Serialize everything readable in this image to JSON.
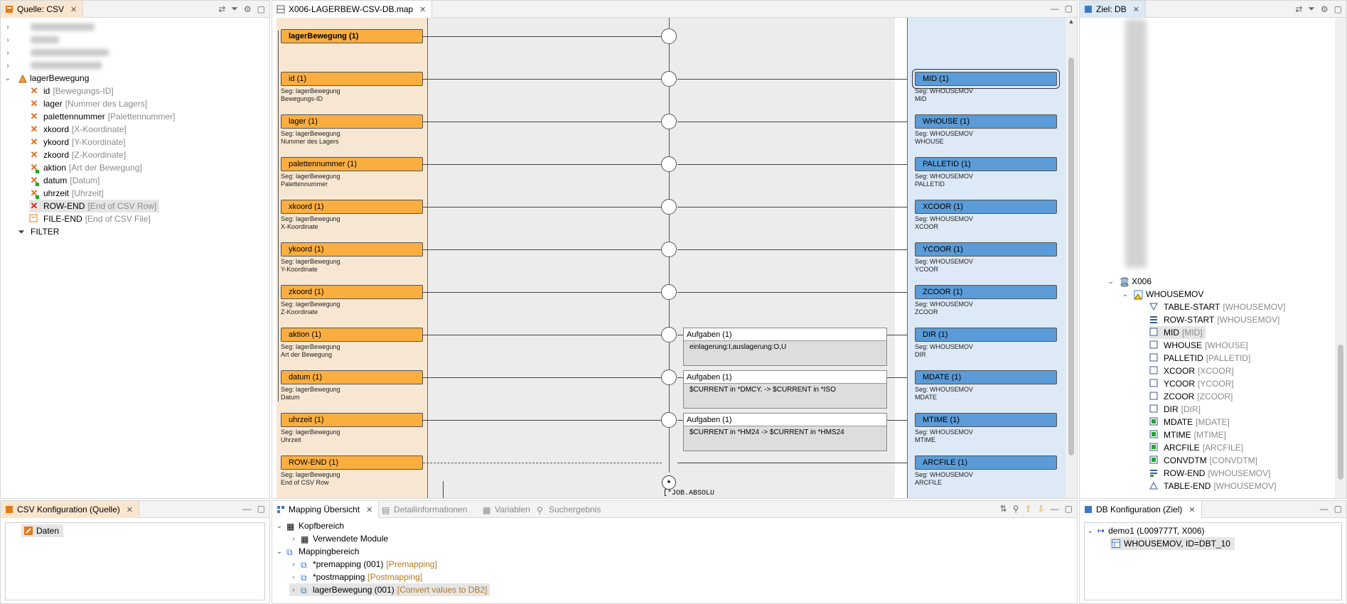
{
  "source_pane": {
    "tab": "Quelle: CSV",
    "root": "lagerBewegung",
    "fields": [
      {
        "name": "id",
        "hint": "[Bewegungs-ID]",
        "mark": "x"
      },
      {
        "name": "lager",
        "hint": "[Nummer des Lagers]",
        "mark": "x"
      },
      {
        "name": "palettennummer",
        "hint": "[Palettennummer]",
        "mark": "x"
      },
      {
        "name": "xkoord",
        "hint": "[X-Koordinate]",
        "mark": "x"
      },
      {
        "name": "ykoord",
        "hint": "[Y-Koordinate]",
        "mark": "x"
      },
      {
        "name": "zkoord",
        "hint": "[Z-Koordinate]",
        "mark": "x"
      },
      {
        "name": "aktion",
        "hint": "[Art der Bewegung]",
        "mark": "xg"
      },
      {
        "name": "datum",
        "hint": "[Datum]",
        "mark": "xg"
      },
      {
        "name": "uhrzeit",
        "hint": "[Uhrzeit]",
        "mark": "xg"
      },
      {
        "name": "ROW-END",
        "hint": "[End of CSV Row]",
        "mark": "xr"
      },
      {
        "name": "FILE-END",
        "hint": "[End of CSV File]",
        "mark": "doc"
      }
    ],
    "filter": "FILTER"
  },
  "map_pane": {
    "tab": "X006-LAGERBEW-CSV-DB.map",
    "header_box": "lagerBewegung (1)",
    "rows": [
      {
        "src": "id (1)",
        "seg1": "Seg: lagerBewegung",
        "seg2": "Bewegungs-ID",
        "tgt": "MID (1)",
        "tseg1": "Seg: WHOUSEMOV",
        "tseg2": "MID"
      },
      {
        "src": "lager (1)",
        "seg1": "Seg: lagerBewegung",
        "seg2": "Nummer des Lagers",
        "tgt": "WHOUSE (1)",
        "tseg1": "Seg: WHOUSEMOV",
        "tseg2": "WHOUSE"
      },
      {
        "src": "palettennummer (1)",
        "seg1": "Seg: lagerBewegung",
        "seg2": "Palettennummer",
        "tgt": "PALLETID (1)",
        "tseg1": "Seg: WHOUSEMOV",
        "tseg2": "PALLETID"
      },
      {
        "src": "xkoord (1)",
        "seg1": "Seg: lagerBewegung",
        "seg2": "X-Koordinate",
        "tgt": "XCOOR (1)",
        "tseg1": "Seg: WHOUSEMOV",
        "tseg2": "XCOOR"
      },
      {
        "src": "ykoord (1)",
        "seg1": "Seg: lagerBewegung",
        "seg2": "Y-Koordinate",
        "tgt": "YCOOR (1)",
        "tseg1": "Seg: WHOUSEMOV",
        "tseg2": "YCOOR"
      },
      {
        "src": "zkoord (1)",
        "seg1": "Seg: lagerBewegung",
        "seg2": "Z-Koordinate",
        "tgt": "ZCOOR (1)",
        "tseg1": "Seg: WHOUSEMOV",
        "tseg2": "ZCOOR"
      },
      {
        "src": "aktion (1)",
        "seg1": "Seg: lagerBewegung",
        "seg2": "Art der Bewegung",
        "tgt": "DIR (1)",
        "tseg1": "Seg: WHOUSEMOV",
        "tseg2": "DIR"
      },
      {
        "src": "datum (1)",
        "seg1": "Seg: lagerBewegung",
        "seg2": "Datum",
        "tgt": "MDATE (1)",
        "tseg1": "Seg: WHOUSEMOV",
        "tseg2": "MDATE"
      },
      {
        "src": "uhrzeit (1)",
        "seg1": "Seg: lagerBewegung",
        "seg2": "Uhrzeit",
        "tgt": "MTIME (1)",
        "tseg1": "Seg: WHOUSEMOV",
        "tseg2": "MTIME"
      },
      {
        "src": "ROW-END (1)",
        "seg1": "Seg: lagerBewegung",
        "seg2": "End of CSV Row",
        "tgt": "ARCFILE (1)",
        "tseg1": "Seg: WHOUSEMOV",
        "tseg2": "ARCFILE"
      }
    ],
    "tasks": [
      {
        "title": "Aufgaben (1)",
        "body": "einlagerung:I,auslagerung:O,U"
      },
      {
        "title": "Aufgaben (1)",
        "body": "$CURRENT in *DMCY. -> $CURRENT in *ISO"
      },
      {
        "title": "Aufgaben (1)",
        "body": "$CURRENT in *HM24 -> $CURRENT in *HMS24"
      }
    ],
    "job_label": "[*JOB.ABSOLU",
    "star": "*"
  },
  "target_pane": {
    "tab": "Ziel: DB",
    "db": "X006",
    "table": "WHOUSEMOV",
    "fields": [
      {
        "name": "TABLE-START",
        "hint": "[WHOUSEMOV]",
        "icon": "tri-down"
      },
      {
        "name": "ROW-START",
        "hint": "[WHOUSEMOV]",
        "icon": "lines"
      },
      {
        "name": "MID",
        "hint": "[MID]",
        "icon": "empty"
      },
      {
        "name": "WHOUSE",
        "hint": "[WHOUSE]",
        "icon": "empty"
      },
      {
        "name": "PALLETID",
        "hint": "[PALLETID]",
        "icon": "empty"
      },
      {
        "name": "XCOOR",
        "hint": "[XCOOR]",
        "icon": "empty"
      },
      {
        "name": "YCOOR",
        "hint": "[YCOOR]",
        "icon": "empty"
      },
      {
        "name": "ZCOOR",
        "hint": "[ZCOOR]",
        "icon": "empty"
      },
      {
        "name": "DIR",
        "hint": "[DIR]",
        "icon": "empty"
      },
      {
        "name": "MDATE",
        "hint": "[MDATE]",
        "icon": "green"
      },
      {
        "name": "MTIME",
        "hint": "[MTIME]",
        "icon": "green"
      },
      {
        "name": "ARCFILE",
        "hint": "[ARCFILE]",
        "icon": "green"
      },
      {
        "name": "CONVDTM",
        "hint": "[CONVDTM]",
        "icon": "green"
      },
      {
        "name": "ROW-END",
        "hint": "[WHOUSEMOV]",
        "icon": "lines-green"
      },
      {
        "name": "TABLE-END",
        "hint": "[WHOUSEMOV]",
        "icon": "tri-up"
      }
    ]
  },
  "csv_config": {
    "tab": "CSV Konfiguration (Quelle)",
    "item": "Daten"
  },
  "overview": {
    "tabs": [
      "Mapping Übersicht",
      "Detailinformationen",
      "Variablen",
      "Suchergebnis"
    ],
    "kopf": "Kopfbereich",
    "module": "Verwendete Module",
    "mapping": "Mappingbereich",
    "items": [
      {
        "label": "*premapping (001)",
        "hint": "[Premapping]"
      },
      {
        "label": "*postmapping",
        "hint": "[Postmapping]"
      },
      {
        "label": "lagerBewegung (001)",
        "hint": "[Convert values to DB2]"
      }
    ]
  },
  "db_config": {
    "tab": "DB Konfiguration (Ziel)",
    "conn": "demo1 (L009777T, X006)",
    "table": "WHOUSEMOV, ID=DBT_10"
  }
}
